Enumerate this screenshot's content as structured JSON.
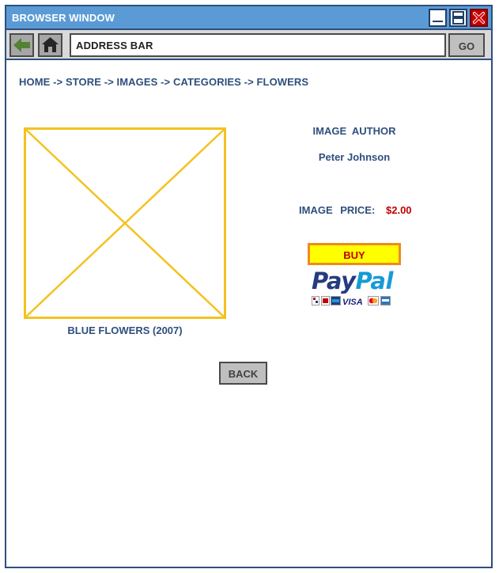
{
  "window": {
    "title": "BROWSER WINDOW",
    "icons": {
      "minimize": "minimize-icon",
      "maximize": "restore-icon",
      "close": "close-icon"
    }
  },
  "toolbar": {
    "back_icon": "back-arrow-icon",
    "home_icon": "home-icon",
    "address_label": "ADDRESS BAR",
    "go_label": "GO"
  },
  "breadcrumb": "HOME -> STORE -> IMAGES -> CATEGORIES -> FLOWERS",
  "image": {
    "caption": "BLUE FLOWERS (2007)"
  },
  "details": {
    "author_label": "IMAGE  AUTHOR",
    "author_name": "Peter Johnson",
    "price_label": "IMAGE PRICE:",
    "price_value": "$2.00"
  },
  "purchase": {
    "buy_label": "BUY",
    "paypal_pay": "Pay",
    "paypal_pal": "Pal",
    "card_logos": [
      "ec-card-icon",
      "giropay-icon",
      "visa-icon",
      "mastercard-icon",
      "amex-icon"
    ]
  },
  "back_label": "BACK",
  "colors": {
    "accent_blue": "#5b9bd5",
    "border_navy": "#2e4f7d",
    "placeholder_gold": "#f4c21f",
    "price_red": "#c00000",
    "buy_yellow": "#ffff00",
    "buy_border_orange": "#f08a1f"
  }
}
